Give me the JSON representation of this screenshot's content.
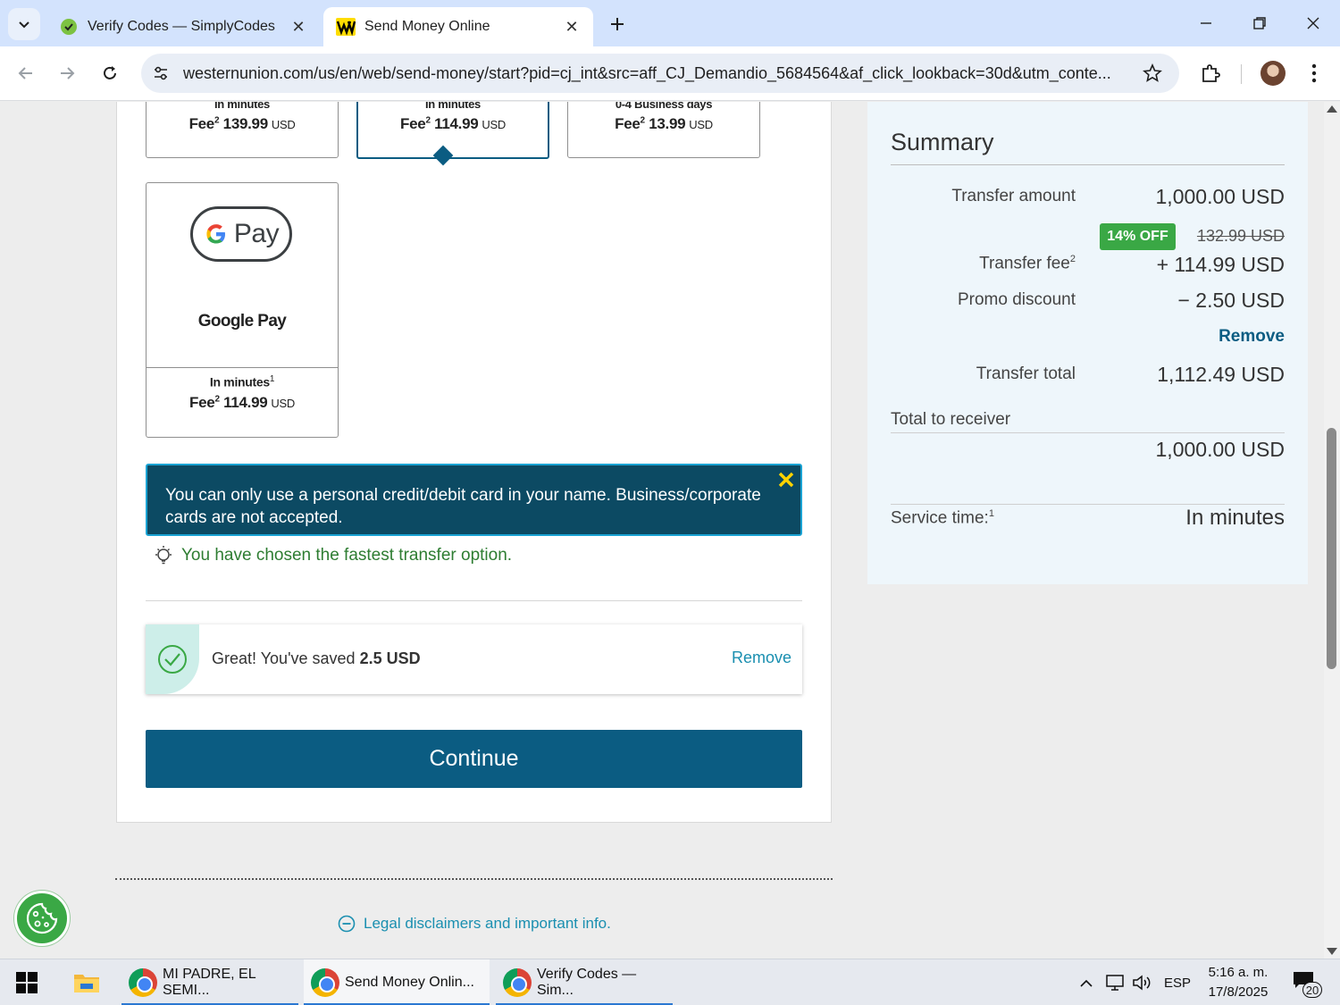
{
  "browser": {
    "tabs": [
      {
        "title": "Verify Codes — SimplyCodes",
        "active": false
      },
      {
        "title": "Send Money Online",
        "active": true
      }
    ],
    "url": "westernunion.com/us/en/web/send-money/start?pid=cj_int&src=aff_CJ_Demandio_5684564&af_click_lookback=30d&utm_conte..."
  },
  "delivery_options": [
    {
      "speed": "In minutes",
      "fee_label": "Fee",
      "fee_sup": "2",
      "fee_amount": "139.99",
      "currency": "USD"
    },
    {
      "speed": "In minutes",
      "fee_label": "Fee",
      "fee_sup": "2",
      "fee_amount": "114.99",
      "currency": "USD",
      "selected": true
    },
    {
      "speed": "0-4 Business days",
      "fee_label": "Fee",
      "fee_sup": "2",
      "fee_amount": "13.99",
      "currency": "USD"
    }
  ],
  "google_pay": {
    "logo_text": "Pay",
    "name": "Google Pay",
    "speed": "In minutes",
    "speed_sup": "1",
    "fee_label": "Fee",
    "fee_sup": "2",
    "fee_amount": "114.99",
    "currency": "USD"
  },
  "notice": {
    "message": "You can only use a personal credit/debit card in your name. Business/corporate cards are not accepted."
  },
  "fastest_text": "You have chosen the fastest transfer option.",
  "promo": {
    "saved_prefix": "Great! You've saved",
    "saved_amount": "2.5 USD",
    "remove_label": "Remove"
  },
  "continue_label": "Continue",
  "legal_link": "Legal disclaimers and important info.",
  "summary": {
    "title": "Summary",
    "transfer_amount_label": "Transfer amount",
    "transfer_amount": "1,000.00 USD",
    "discount_badge": "14% OFF",
    "original_fee": "132.99 USD",
    "transfer_fee_label": "Transfer fee",
    "transfer_fee_sup": "2",
    "transfer_fee": "+ 114.99 USD",
    "promo_discount_label": "Promo discount",
    "promo_discount": "− 2.50 USD",
    "remove_label": "Remove",
    "transfer_total_label": "Transfer total",
    "transfer_total": "1,112.49 USD",
    "receiver_label": "Total  to receiver",
    "receiver_amount": "1,000.00 USD",
    "service_time_label": "Service time:",
    "service_time_sup": "1",
    "service_time": "In minutes"
  },
  "taskbar": {
    "apps": [
      {
        "title": "MI PADRE, EL SEMI..."
      },
      {
        "title": "Send Money Onlin..."
      },
      {
        "title": "Verify Codes — Sim..."
      }
    ],
    "language": "ESP",
    "time": "5:16 a. m.",
    "date": "17/8/2025",
    "notification_count": "20"
  },
  "colors": {
    "brand_blue": "#0b5c82",
    "notice_bg": "#0c4a63",
    "success_green": "#3aa845",
    "link_teal": "#1a8fb0",
    "summary_bg": "#eef6fb"
  }
}
